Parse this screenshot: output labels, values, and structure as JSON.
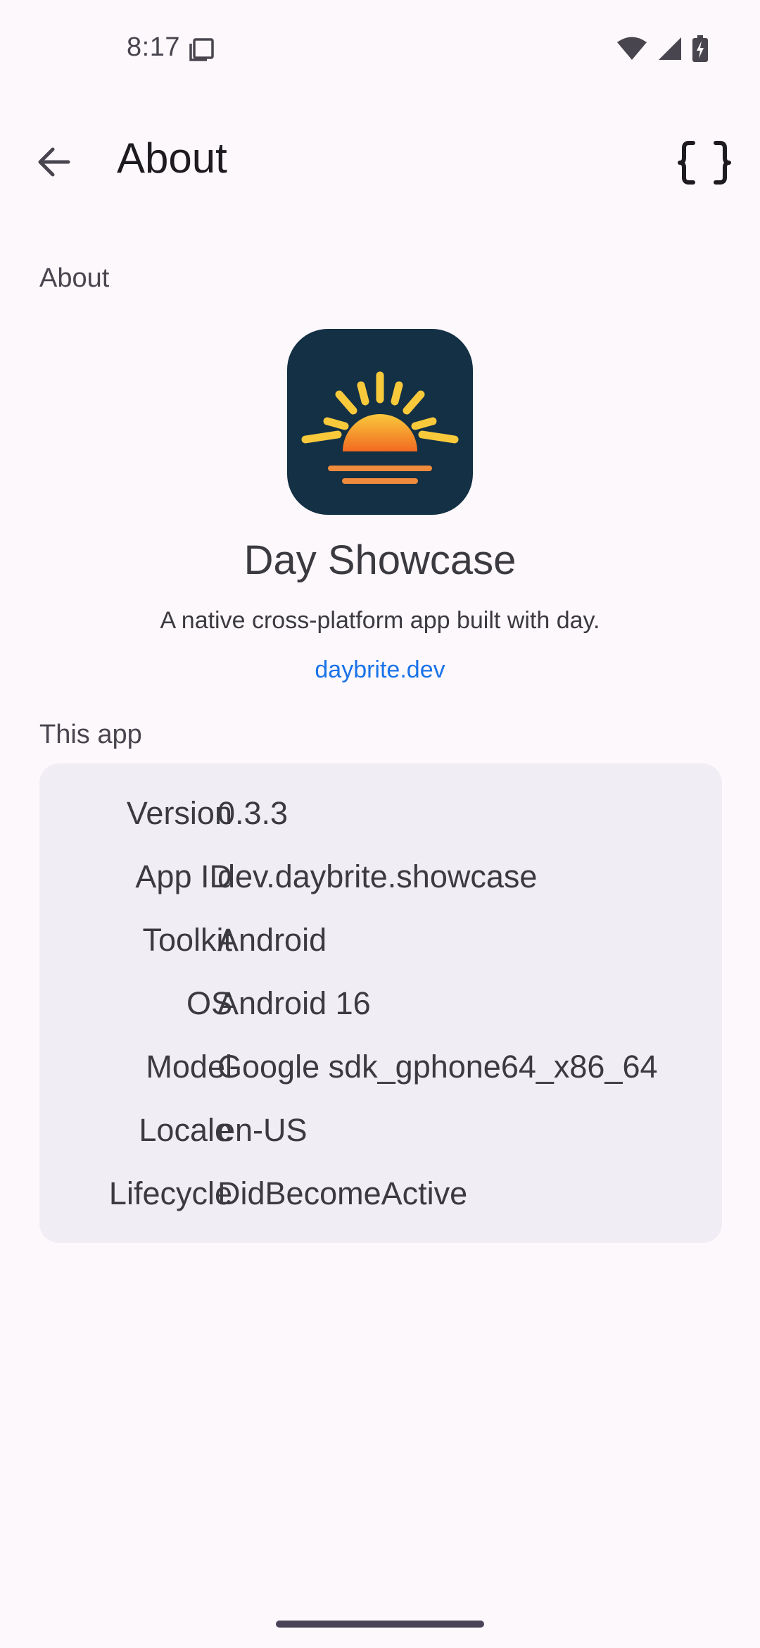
{
  "status_bar": {
    "time": "8:17",
    "icons": [
      "notification-copy-icon",
      "wifi-icon",
      "signal-icon",
      "battery-charging-icon"
    ]
  },
  "top_bar": {
    "title": "About",
    "back_icon": "arrow-left-icon",
    "action_icon": "curly-braces-icon"
  },
  "about_section": {
    "label": "About",
    "app_name": "Day Showcase",
    "tagline": "A native cross-platform app built with day.",
    "link": "daybrite.dev"
  },
  "this_app_section": {
    "label": "This app",
    "rows": [
      {
        "key": "Version",
        "value": "0.3.3"
      },
      {
        "key": "App ID",
        "value": "dev.daybrite.showcase"
      },
      {
        "key": "Toolkit",
        "value": "Android"
      },
      {
        "key": "OS",
        "value": "Android 16"
      },
      {
        "key": "Model",
        "value": "Google sdk_gphone64_x86_64"
      },
      {
        "key": "Locale",
        "value": "en-US"
      },
      {
        "key": "Lifecycle",
        "value": "DidBecomeActive"
      }
    ]
  },
  "colors": {
    "background": "#fdf8fc",
    "card": "#f1edf4",
    "link": "#1a73e8",
    "icon_bg": "#133044",
    "sun_yellow": "#f9c93c",
    "sun_orange": "#f26a21"
  }
}
